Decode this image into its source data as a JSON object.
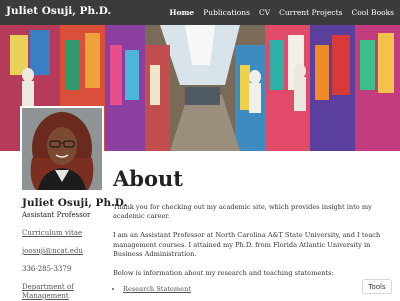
{
  "site": {
    "title": "Juliet Osuji, Ph.D."
  },
  "nav": [
    {
      "label": "Home",
      "active": true
    },
    {
      "label": "Publications",
      "active": false
    },
    {
      "label": "CV",
      "active": false
    },
    {
      "label": "Current Projects",
      "active": false
    },
    {
      "label": "Cool Books",
      "active": false
    }
  ],
  "sidebar": {
    "name": "Juliet Osuji, Ph.D.",
    "role": "Assistant Professor",
    "cv_link": "Curriculum vitae",
    "email": "joosuji@ncat.edu",
    "phone": "336-285-3379",
    "department_link": "Department of Management"
  },
  "main": {
    "title": "About",
    "paragraphs": [
      "Thank you for checking out my academic site, which provides insight into my academic career.",
      "I am an Assistant Professor at North Carolina A&T State University, and I teach management courses. I attained my Ph.D. from Florida Atlantic University in Business Administration.",
      "Below is information about my research and teaching statements:"
    ],
    "links": [
      "Research Statement"
    ]
  },
  "tools": {
    "label": "Tools"
  }
}
